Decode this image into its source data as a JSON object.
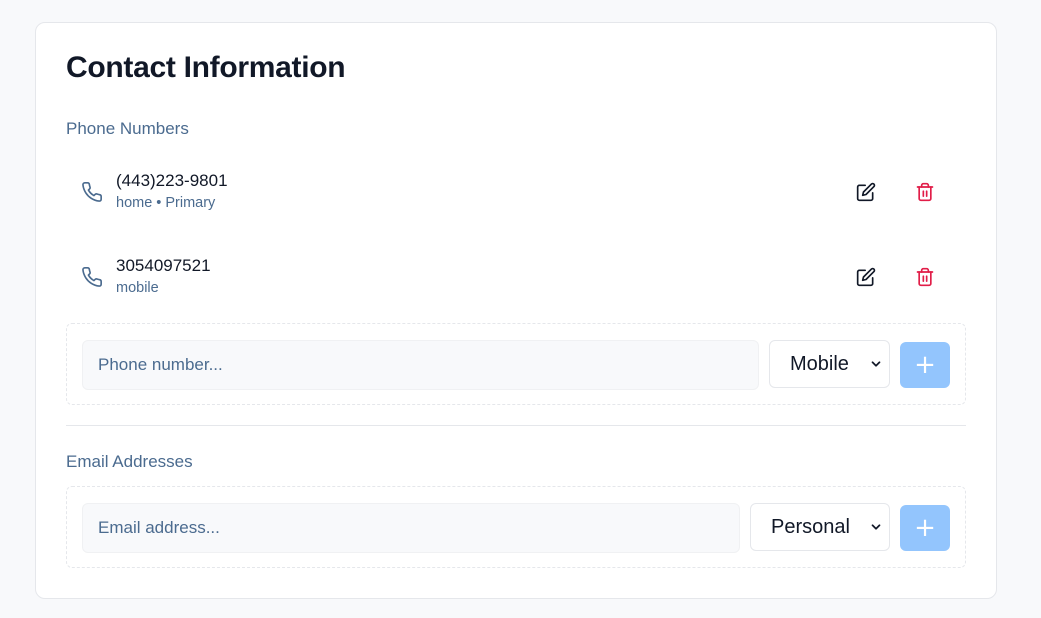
{
  "card": {
    "title": "Contact Information"
  },
  "phones": {
    "section_label": "Phone Numbers",
    "items": [
      {
        "number": "(443)223-9801",
        "type": "home",
        "primary_label": "Primary",
        "separator": "•"
      },
      {
        "number": "3054097521",
        "type": "mobile"
      }
    ],
    "add_form": {
      "placeholder": "Phone number...",
      "type_selected": "Mobile",
      "add_label": "+"
    }
  },
  "emails": {
    "section_label": "Email Addresses",
    "add_form": {
      "placeholder": "Email address...",
      "type_selected": "Personal",
      "add_label": "+"
    }
  },
  "colors": {
    "accent_label": "#4b6b8f",
    "delete": "#e11d48",
    "add_button": "#93c5fd"
  },
  "icons": {
    "phone": "phone-icon",
    "edit": "pencil-square-icon",
    "delete": "trash-icon",
    "dropdown": "chevron-down-icon"
  }
}
